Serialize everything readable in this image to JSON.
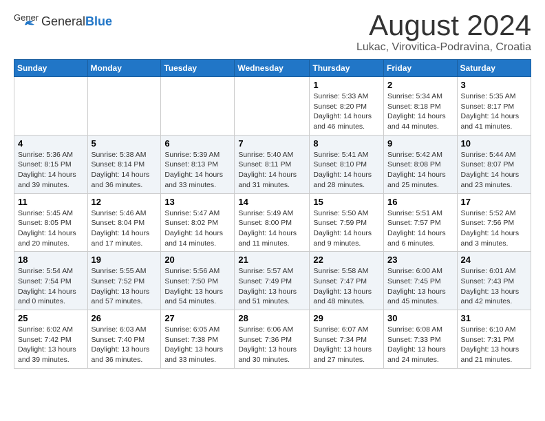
{
  "header": {
    "logo_general": "General",
    "logo_blue": "Blue",
    "month_title": "August 2024",
    "location": "Lukac, Virovitica-Podravina, Croatia"
  },
  "days_of_week": [
    "Sunday",
    "Monday",
    "Tuesday",
    "Wednesday",
    "Thursday",
    "Friday",
    "Saturday"
  ],
  "weeks": [
    [
      {
        "day": "",
        "info": ""
      },
      {
        "day": "",
        "info": ""
      },
      {
        "day": "",
        "info": ""
      },
      {
        "day": "",
        "info": ""
      },
      {
        "day": "1",
        "info": "Sunrise: 5:33 AM\nSunset: 8:20 PM\nDaylight: 14 hours\nand 46 minutes."
      },
      {
        "day": "2",
        "info": "Sunrise: 5:34 AM\nSunset: 8:18 PM\nDaylight: 14 hours\nand 44 minutes."
      },
      {
        "day": "3",
        "info": "Sunrise: 5:35 AM\nSunset: 8:17 PM\nDaylight: 14 hours\nand 41 minutes."
      }
    ],
    [
      {
        "day": "4",
        "info": "Sunrise: 5:36 AM\nSunset: 8:15 PM\nDaylight: 14 hours\nand 39 minutes."
      },
      {
        "day": "5",
        "info": "Sunrise: 5:38 AM\nSunset: 8:14 PM\nDaylight: 14 hours\nand 36 minutes."
      },
      {
        "day": "6",
        "info": "Sunrise: 5:39 AM\nSunset: 8:13 PM\nDaylight: 14 hours\nand 33 minutes."
      },
      {
        "day": "7",
        "info": "Sunrise: 5:40 AM\nSunset: 8:11 PM\nDaylight: 14 hours\nand 31 minutes."
      },
      {
        "day": "8",
        "info": "Sunrise: 5:41 AM\nSunset: 8:10 PM\nDaylight: 14 hours\nand 28 minutes."
      },
      {
        "day": "9",
        "info": "Sunrise: 5:42 AM\nSunset: 8:08 PM\nDaylight: 14 hours\nand 25 minutes."
      },
      {
        "day": "10",
        "info": "Sunrise: 5:44 AM\nSunset: 8:07 PM\nDaylight: 14 hours\nand 23 minutes."
      }
    ],
    [
      {
        "day": "11",
        "info": "Sunrise: 5:45 AM\nSunset: 8:05 PM\nDaylight: 14 hours\nand 20 minutes."
      },
      {
        "day": "12",
        "info": "Sunrise: 5:46 AM\nSunset: 8:04 PM\nDaylight: 14 hours\nand 17 minutes."
      },
      {
        "day": "13",
        "info": "Sunrise: 5:47 AM\nSunset: 8:02 PM\nDaylight: 14 hours\nand 14 minutes."
      },
      {
        "day": "14",
        "info": "Sunrise: 5:49 AM\nSunset: 8:00 PM\nDaylight: 14 hours\nand 11 minutes."
      },
      {
        "day": "15",
        "info": "Sunrise: 5:50 AM\nSunset: 7:59 PM\nDaylight: 14 hours\nand 9 minutes."
      },
      {
        "day": "16",
        "info": "Sunrise: 5:51 AM\nSunset: 7:57 PM\nDaylight: 14 hours\nand 6 minutes."
      },
      {
        "day": "17",
        "info": "Sunrise: 5:52 AM\nSunset: 7:56 PM\nDaylight: 14 hours\nand 3 minutes."
      }
    ],
    [
      {
        "day": "18",
        "info": "Sunrise: 5:54 AM\nSunset: 7:54 PM\nDaylight: 14 hours\nand 0 minutes."
      },
      {
        "day": "19",
        "info": "Sunrise: 5:55 AM\nSunset: 7:52 PM\nDaylight: 13 hours\nand 57 minutes."
      },
      {
        "day": "20",
        "info": "Sunrise: 5:56 AM\nSunset: 7:50 PM\nDaylight: 13 hours\nand 54 minutes."
      },
      {
        "day": "21",
        "info": "Sunrise: 5:57 AM\nSunset: 7:49 PM\nDaylight: 13 hours\nand 51 minutes."
      },
      {
        "day": "22",
        "info": "Sunrise: 5:58 AM\nSunset: 7:47 PM\nDaylight: 13 hours\nand 48 minutes."
      },
      {
        "day": "23",
        "info": "Sunrise: 6:00 AM\nSunset: 7:45 PM\nDaylight: 13 hours\nand 45 minutes."
      },
      {
        "day": "24",
        "info": "Sunrise: 6:01 AM\nSunset: 7:43 PM\nDaylight: 13 hours\nand 42 minutes."
      }
    ],
    [
      {
        "day": "25",
        "info": "Sunrise: 6:02 AM\nSunset: 7:42 PM\nDaylight: 13 hours\nand 39 minutes."
      },
      {
        "day": "26",
        "info": "Sunrise: 6:03 AM\nSunset: 7:40 PM\nDaylight: 13 hours\nand 36 minutes."
      },
      {
        "day": "27",
        "info": "Sunrise: 6:05 AM\nSunset: 7:38 PM\nDaylight: 13 hours\nand 33 minutes."
      },
      {
        "day": "28",
        "info": "Sunrise: 6:06 AM\nSunset: 7:36 PM\nDaylight: 13 hours\nand 30 minutes."
      },
      {
        "day": "29",
        "info": "Sunrise: 6:07 AM\nSunset: 7:34 PM\nDaylight: 13 hours\nand 27 minutes."
      },
      {
        "day": "30",
        "info": "Sunrise: 6:08 AM\nSunset: 7:33 PM\nDaylight: 13 hours\nand 24 minutes."
      },
      {
        "day": "31",
        "info": "Sunrise: 6:10 AM\nSunset: 7:31 PM\nDaylight: 13 hours\nand 21 minutes."
      }
    ]
  ]
}
